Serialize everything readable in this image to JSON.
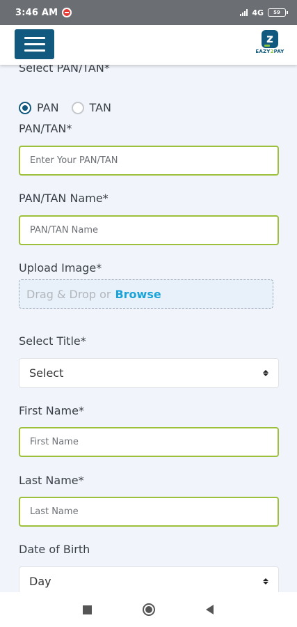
{
  "status_bar": {
    "time": "3:46 AM",
    "network": "4G",
    "battery": "59"
  },
  "header": {
    "logo_text_a": "EAZY",
    "logo_text_b": "PAY",
    "logo_sub": "",
    "colors": {
      "primary": "#11597e",
      "accent": "#8cc63f"
    }
  },
  "form": {
    "select_type_label": "Select PAN/TAN*",
    "radio_options": [
      {
        "label": "PAN",
        "checked": true
      },
      {
        "label": "TAN",
        "checked": false
      }
    ],
    "pan_tan_label": "PAN/TAN*",
    "pan_tan_placeholder": "Enter Your PAN/TAN",
    "pan_tan_name_label": "PAN/TAN Name*",
    "pan_tan_name_placeholder": "PAN/TAN Name",
    "upload_label": "Upload Image*",
    "upload_text": "Drag & Drop or",
    "upload_browse": "Browse",
    "title_label": "Select Title*",
    "title_value": "Select",
    "first_name_label": "First Name*",
    "first_name_placeholder": "First Name",
    "last_name_label": "Last Name*",
    "last_name_placeholder": "Last Name",
    "dob_label": "Date of Birth",
    "dob_day_value": "Day"
  },
  "nav": {
    "icons": [
      "recents-icon",
      "home-icon",
      "back-icon"
    ]
  }
}
